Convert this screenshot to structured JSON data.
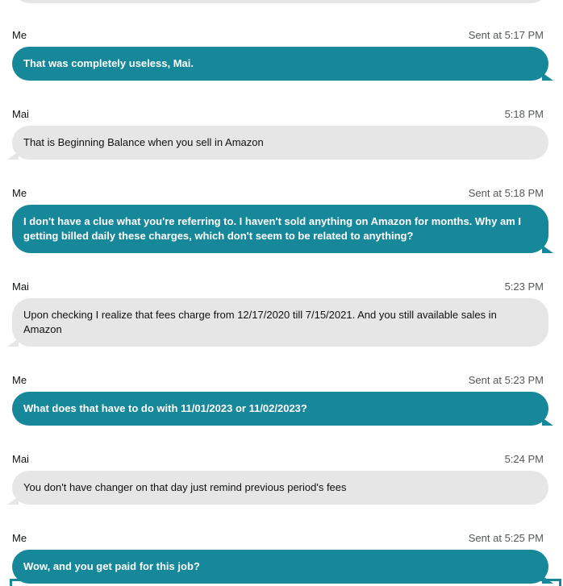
{
  "messages": [
    {
      "sender": "Me",
      "time": "Sent at 5:17 PM",
      "text": "That was completely useless, Mai.",
      "outgoing": true
    },
    {
      "sender": "Mai",
      "time": "5:18 PM",
      "text": "That is Beginning Balance when you sell in Amazon",
      "outgoing": false
    },
    {
      "sender": "Me",
      "time": "Sent at 5:18 PM",
      "text": "I don't have a clue what you're referring to. I haven't sold anything on Amazon for months. Why am I getting billed daily these charges, which don't seem to be related to anything?",
      "outgoing": true
    },
    {
      "sender": "Mai",
      "time": "5:23 PM",
      "text": "Upon checking I realize that fees charge from 12/17/2020 till 7/15/2021. And you still available sales in Amazon",
      "outgoing": false
    },
    {
      "sender": "Me",
      "time": "Sent at 5:23 PM",
      "text": "What does that have to do with 11/01/2023 or 11/02/2023?",
      "outgoing": true
    },
    {
      "sender": "Mai",
      "time": "5:24 PM",
      "text": "You don't have changer on that day just remind previous period's fees",
      "outgoing": false
    },
    {
      "sender": "Me",
      "time": "Sent at 5:25 PM",
      "text": "Wow, and you get paid for this job?",
      "outgoing": true
    }
  ],
  "colors": {
    "outgoing_bubble": "#17879a",
    "incoming_bubble": "#e6e6e6"
  }
}
